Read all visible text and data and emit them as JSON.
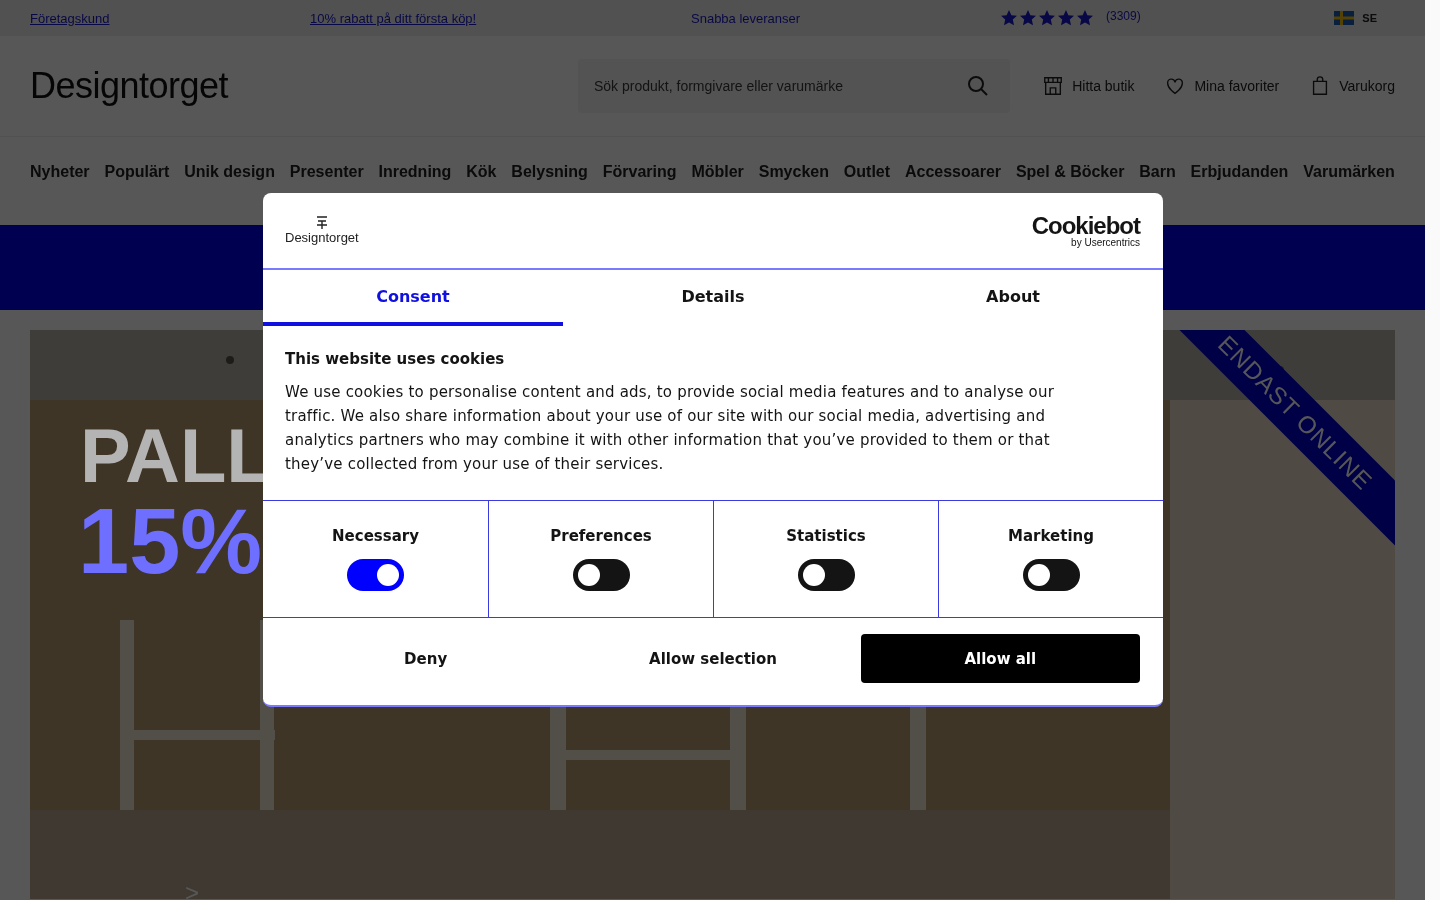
{
  "top_bar": {
    "items": [
      {
        "text": "Företagskund",
        "kind": "link"
      },
      {
        "text": "10% rabatt på ditt första köp!",
        "kind": "link"
      },
      {
        "text": "Snabba leveranser",
        "kind": "text"
      }
    ],
    "rating": {
      "stars": 5,
      "count": "(3309)"
    },
    "country": "SE"
  },
  "header": {
    "logo": "Designtorget",
    "search": {
      "placeholder": "Sök produkt, formgivare eller varumärke"
    },
    "actions": [
      {
        "label": "Hitta butik",
        "kind": "store"
      },
      {
        "label": "Mina favoriter",
        "kind": "heart"
      },
      {
        "label": "Varukorg",
        "kind": "bag"
      }
    ]
  },
  "nav": [
    "Nyheter",
    "Populärt",
    "Unik design",
    "Presenter",
    "Inredning",
    "Kök",
    "Belysning",
    "Förvaring",
    "Möbler",
    "Smycken",
    "Outlet",
    "Accessoarer",
    "Spel & Böcker",
    "Barn",
    "Erbjudanden",
    "Varumärken"
  ],
  "hero": {
    "kind": "picture",
    "headline": "PALL",
    "discount": "15%",
    "ribbon": "ENDAST ONLINE",
    "next": ">"
  },
  "consent": {
    "brand": "Designtorget",
    "provider": "Cookiebot",
    "provider_sub": "by Usercentrics",
    "tabs": [
      {
        "label": "Consent",
        "selected": true
      },
      {
        "label": "Details",
        "selected": false
      },
      {
        "label": "About",
        "selected": false
      }
    ],
    "title": "This website uses cookies",
    "body": "We use cookies to personalise content and ads, to provide social media features and to analyse our traffic. We also share information about your use of our site with our social media, advertising and analytics partners who may combine it with other information that you’ve provided to them or that they’ve collected from your use of their services.",
    "categories": [
      {
        "label": "Necessary",
        "checked": true
      },
      {
        "label": "Preferences",
        "checked": false
      },
      {
        "label": "Statistics",
        "checked": false
      },
      {
        "label": "Marketing",
        "checked": false
      }
    ],
    "buttons": [
      {
        "label": "Deny",
        "kind": "plain"
      },
      {
        "label": "Allow selection",
        "kind": "plain"
      },
      {
        "label": "Allow all",
        "kind": "primary"
      }
    ]
  }
}
